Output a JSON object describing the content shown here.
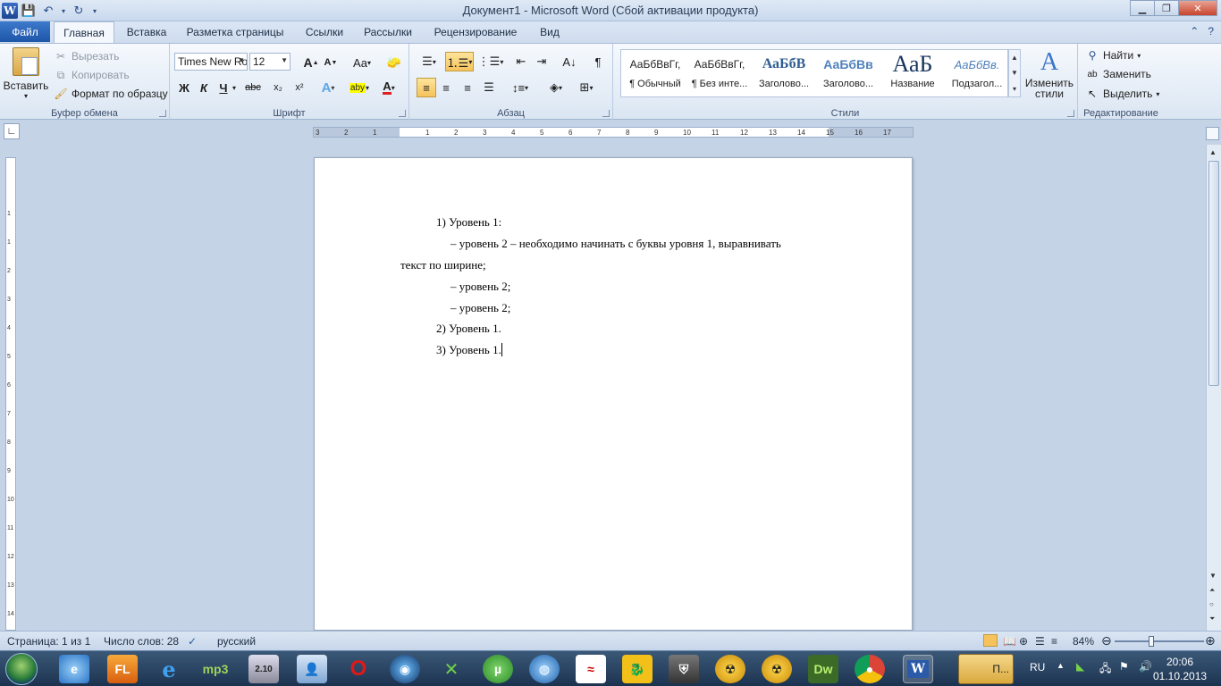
{
  "window": {
    "title": "Документ1  -  Microsoft Word (Сбой активации продукта)",
    "app_icon_letter": "W"
  },
  "tabs": [
    "Файл",
    "Главная",
    "Вставка",
    "Разметка страницы",
    "Ссылки",
    "Рассылки",
    "Рецензирование",
    "Вид"
  ],
  "active_tab": "Главная",
  "clipboard": {
    "paste": "Вставить",
    "cut": "Вырезать",
    "copy": "Копировать",
    "format_painter": "Формат по образцу",
    "label": "Буфер обмена"
  },
  "font": {
    "name": "Times New Ro",
    "size": "12",
    "label": "Шрифт",
    "bold": "Ж",
    "italic": "К",
    "underline": "Ч",
    "strike": "abc",
    "subscript": "x₂",
    "superscript": "x²",
    "change_case": "Aa",
    "grow": "A",
    "shrink": "A",
    "text_effect": "A",
    "highlight": "aby",
    "color": "A"
  },
  "paragraph": {
    "label": "Абзац"
  },
  "styles": {
    "label": "Стили",
    "items": [
      {
        "sample": "АаБбВвГг,",
        "name": "¶ Обычный"
      },
      {
        "sample": "АаБбВвГг,",
        "name": "¶ Без инте..."
      },
      {
        "sample": "АаБбВ",
        "name": "Заголово..."
      },
      {
        "sample": "АаБбВв",
        "name": "Заголово..."
      },
      {
        "sample": "АаБ",
        "name": "Название"
      },
      {
        "sample": "АаБбВв.",
        "name": "Подзагол..."
      }
    ],
    "change_styles": "Изменить стили"
  },
  "editing": {
    "label": "Редактирование",
    "find": "Найти",
    "replace": "Заменить",
    "select": "Выделить"
  },
  "ruler": {
    "h_ticks": [
      "3",
      "2",
      "1",
      "1",
      "2",
      "3",
      "4",
      "5",
      "6",
      "7",
      "8",
      "9",
      "10",
      "11",
      "12",
      "13",
      "14",
      "15",
      "16",
      "17"
    ],
    "v_ticks": [
      "1",
      "1",
      "2",
      "3",
      "4",
      "5",
      "6",
      "7",
      "8",
      "9",
      "10",
      "11",
      "12",
      "13",
      "14"
    ]
  },
  "document": {
    "lines": [
      "1) Уровень 1:",
      "–  уровень 2 – необходимо начинать с буквы уровня 1, выравнивать",
      "текст по ширине;",
      "–  уровень 2;",
      "–  уровень 2;",
      "2) Уровень 1.",
      "3) Уровень 1."
    ]
  },
  "status": {
    "page": "Страница: 1 из 1",
    "words": "Число слов: 28",
    "language": "русский",
    "zoom": "84%",
    "zoom_percent": 84
  },
  "taskbar": {
    "apps": [
      "IE-stack",
      "FL",
      "e",
      "mp3",
      "2.10",
      "contacts",
      "O",
      "media",
      "xbox",
      "µ",
      "globe",
      "snake",
      "dragon",
      "tanks",
      "radiation",
      "radiation2",
      "Dw",
      "chrome",
      "W"
    ],
    "running_task": "П...",
    "lang": "RU",
    "time": "20:06",
    "date": "01.10.2013"
  },
  "colors": {
    "file_tab": "#2a65b8",
    "highlight": "#ffff00",
    "font_color": "#e02020",
    "active_button": "#f6c25c"
  }
}
